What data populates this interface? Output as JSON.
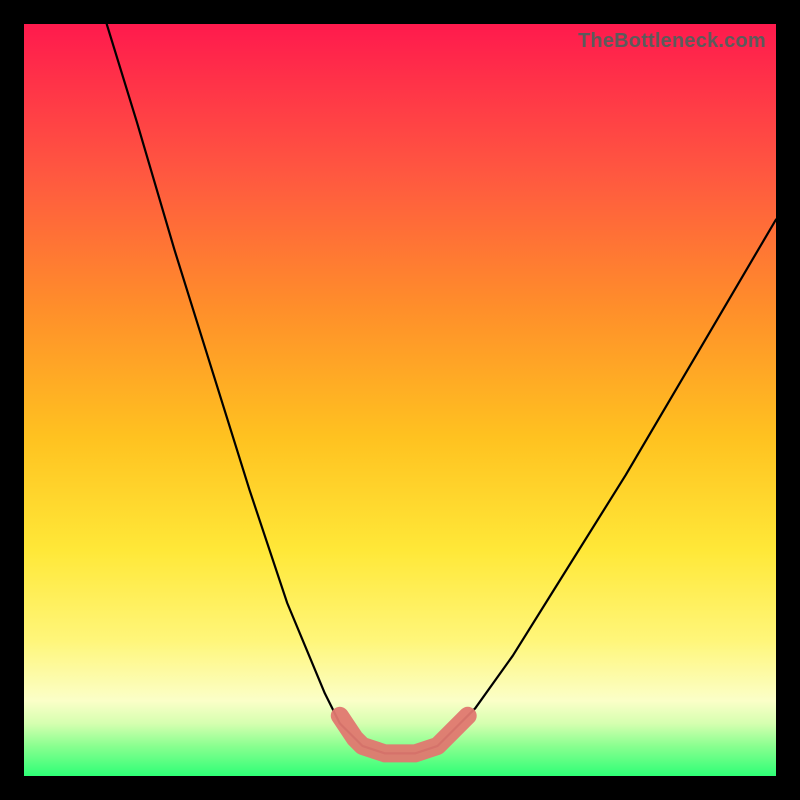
{
  "watermark": "TheBottleneck.com",
  "colors": {
    "frame": "#000000",
    "curve": "#000000",
    "valley_highlight": "#e07870",
    "gradient_top": "#ff1a4d",
    "gradient_bottom": "#2eff76"
  },
  "chart_data": {
    "type": "line",
    "title": "",
    "xlabel": "",
    "ylabel": "",
    "xlim": [
      0,
      100
    ],
    "ylim": [
      0,
      100
    ],
    "note": "No axes, ticks, or numeric labels are visible in the image. Values below are estimated from geometry, expressed as percentages of the plot area (0,0 = top-left of gradient, 100,100 = bottom-right).",
    "series": [
      {
        "name": "left-branch",
        "x": [
          11,
          15,
          20,
          25,
          30,
          35,
          40,
          42,
          44,
          45
        ],
        "y": [
          0,
          13,
          30,
          46,
          62,
          77,
          89,
          93,
          95,
          96
        ]
      },
      {
        "name": "valley-floor",
        "x": [
          45,
          48,
          52,
          55
        ],
        "y": [
          96,
          97,
          97,
          96
        ]
      },
      {
        "name": "right-branch",
        "x": [
          55,
          57,
          60,
          65,
          70,
          80,
          90,
          100
        ],
        "y": [
          96,
          94,
          91,
          84,
          76,
          60,
          43,
          26
        ]
      }
    ],
    "highlight": {
      "name": "valley-highlight",
      "description": "Thick salmon-colored stroke overlaying the bottom of the V",
      "x": [
        42,
        44,
        45,
        48,
        52,
        55,
        57,
        59
      ],
      "y": [
        92,
        95,
        96,
        97,
        97,
        96,
        94,
        92
      ]
    }
  }
}
